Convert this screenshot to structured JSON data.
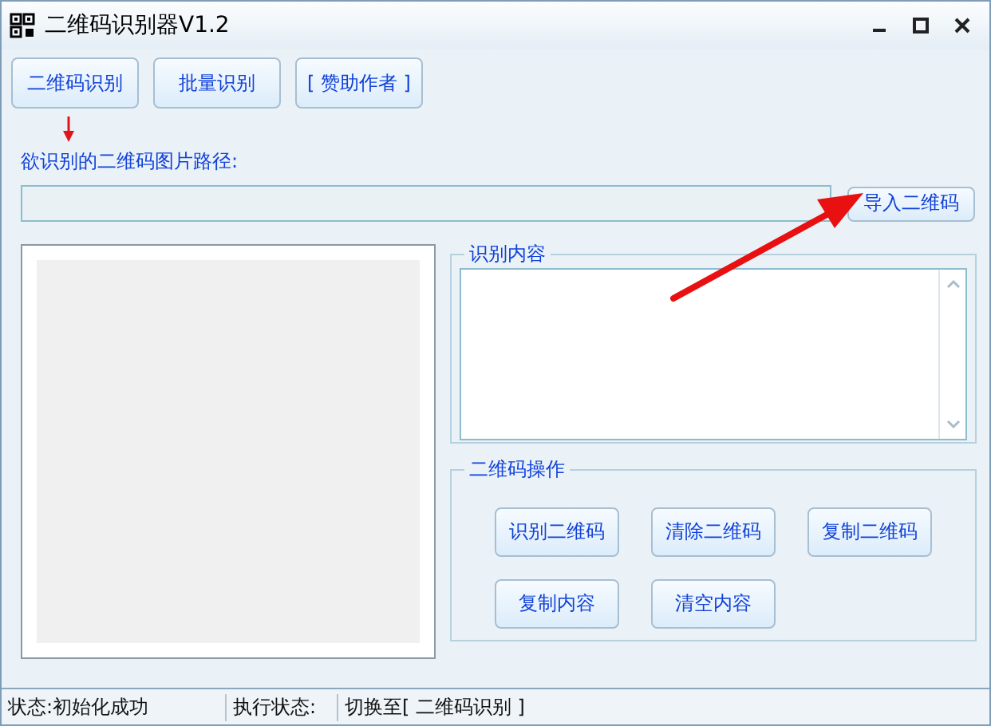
{
  "window": {
    "title": "二维码识别器V1.2"
  },
  "toolbar": [
    "二维码识别",
    "批量识别",
    "[ 赞助作者 ]"
  ],
  "path": {
    "label": "欲识别的二维码图片路径:",
    "button": "导入二维码"
  },
  "result_group": {
    "title": "识别内容"
  },
  "operations": {
    "title": "二维码操作",
    "buttons": [
      "识别二维码",
      "清除二维码",
      "复制二维码",
      "复制内容",
      "清空内容"
    ]
  },
  "status_bar": [
    "状态:初始化成功",
    "执行状态:",
    "切换至[ 二维码识别 ]"
  ]
}
